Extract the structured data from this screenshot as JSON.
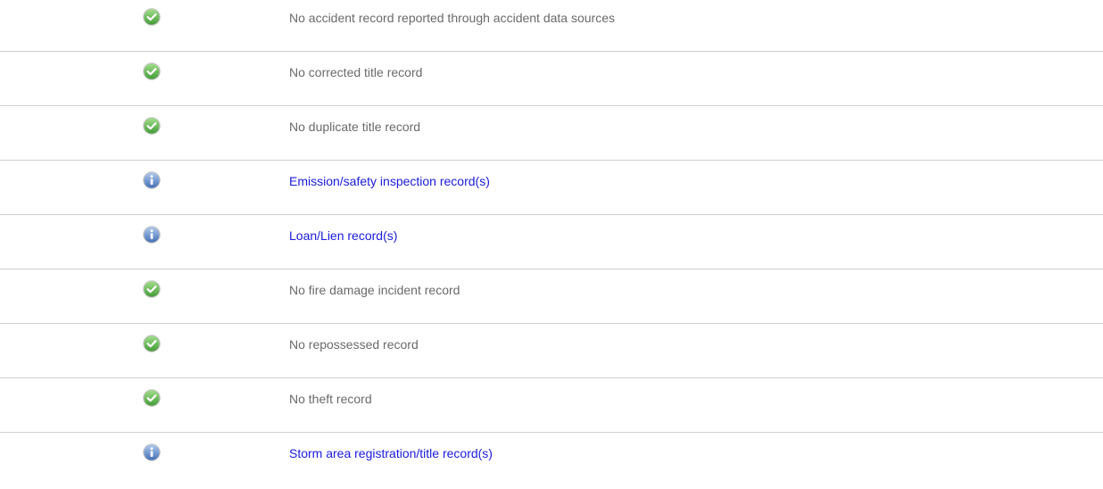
{
  "colors": {
    "ok": "#5cb85c",
    "info": "#5b86c4",
    "link": "#1a1adc",
    "text": "#6a6a6a",
    "divider": "#cfcfcf"
  },
  "records": [
    {
      "status": "ok",
      "icon": "check-circle-icon",
      "text": "No accident record reported through accident data sources",
      "link": false
    },
    {
      "status": "ok",
      "icon": "check-circle-icon",
      "text": "No corrected title record",
      "link": false
    },
    {
      "status": "ok",
      "icon": "check-circle-icon",
      "text": "No duplicate title record",
      "link": false
    },
    {
      "status": "info",
      "icon": "info-circle-icon",
      "text": "Emission/safety inspection record(s)",
      "link": true
    },
    {
      "status": "info",
      "icon": "info-circle-icon",
      "text": "Loan/Lien record(s)",
      "link": true
    },
    {
      "status": "ok",
      "icon": "check-circle-icon",
      "text": "No fire damage incident record",
      "link": false
    },
    {
      "status": "ok",
      "icon": "check-circle-icon",
      "text": "No repossessed record",
      "link": false
    },
    {
      "status": "ok",
      "icon": "check-circle-icon",
      "text": "No theft record",
      "link": false
    },
    {
      "status": "info",
      "icon": "info-circle-icon",
      "text": "Storm area registration/title record(s)",
      "link": true
    }
  ]
}
